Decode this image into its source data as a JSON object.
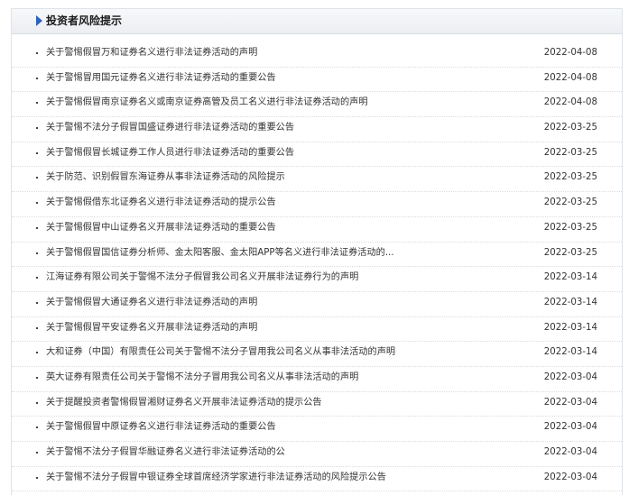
{
  "header": {
    "title": "投资者风险提示"
  },
  "items": [
    {
      "title": "关于警惕假冒万和证券名义进行非法证券活动的声明",
      "date": "2022-04-08"
    },
    {
      "title": "关于警惕冒用国元证券名义进行非法证券活动的重要公告",
      "date": "2022-04-08"
    },
    {
      "title": "关于警惕假冒南京证券名义或南京证券高管及员工名义进行非法证券活动的声明",
      "date": "2022-04-08"
    },
    {
      "title": "关于警惕不法分子假冒国盛证券进行非法证券活动的重要公告",
      "date": "2022-03-25"
    },
    {
      "title": "关于警惕假冒长城证券工作人员进行非法证券活动的重要公告",
      "date": "2022-03-25"
    },
    {
      "title": "关于防范、识别假冒东海证券从事非法证券活动的风险提示",
      "date": "2022-03-25"
    },
    {
      "title": "关于警惕假借东北证券名义进行非法证券活动的提示公告",
      "date": "2022-03-25"
    },
    {
      "title": "关于警惕假冒中山证券名义开展非法证券活动的重要公告",
      "date": "2022-03-25"
    },
    {
      "title": "关于警惕假冒国信证券分析师、金太阳客服、金太阳APP等名义进行非法证券活动的...",
      "date": "2022-03-25"
    },
    {
      "title": "江海证券有限公司关于警惕不法分子假冒我公司名义开展非法证券行为的声明",
      "date": "2022-03-14"
    },
    {
      "title": "关于警惕假冒大通证券名义进行非法证券活动的声明",
      "date": "2022-03-14"
    },
    {
      "title": "关于警惕假冒平安证券名义开展非法证券活动的声明",
      "date": "2022-03-14"
    },
    {
      "title": "大和证券（中国）有限责任公司关于警惕不法分子冒用我公司名义从事非法活动的声明",
      "date": "2022-03-14"
    },
    {
      "title": "英大证券有限责任公司关于警惕不法分子冒用我公司名义从事非法活动的声明",
      "date": "2022-03-04"
    },
    {
      "title": "关于提醒投资者警惕假冒湘财证券名义开展非法证券活动的提示公告",
      "date": "2022-03-04"
    },
    {
      "title": "关于警惕假冒中原证券名义进行非法证券活动的重要公告",
      "date": "2022-03-04"
    },
    {
      "title": "关于警惕不法分子假冒华融证券名义进行非法证券活动的公",
      "date": "2022-03-04"
    },
    {
      "title": "关于警惕不法分子假冒中银证券全球首席经济学家进行非法证券活动的风险提示公告",
      "date": "2022-03-04"
    }
  ]
}
